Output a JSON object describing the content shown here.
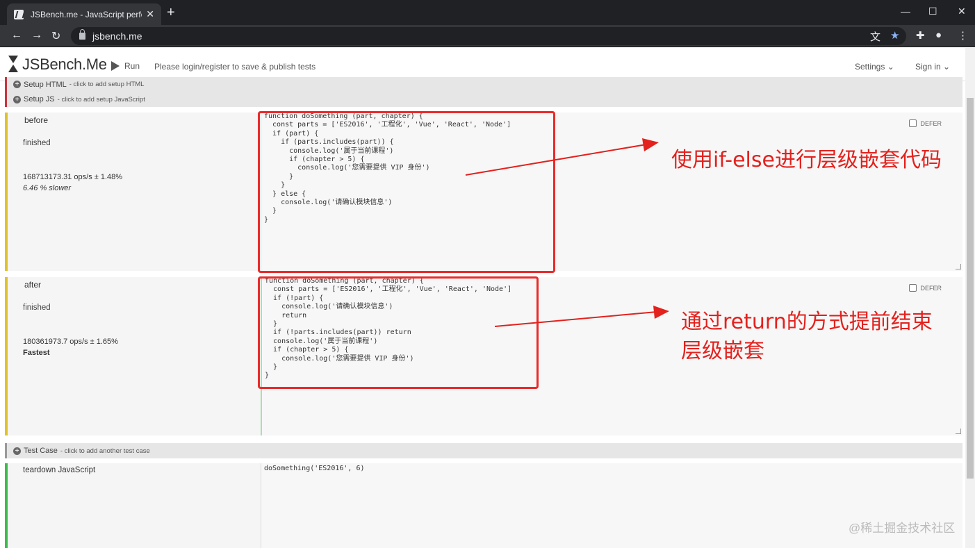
{
  "browser": {
    "tab_title": "JSBench.me - JavaScript perfo",
    "url": "jsbench.me"
  },
  "header": {
    "logo": "JSBench.Me",
    "run_label": "Run",
    "login_msg": "Please login/register to save & publish tests",
    "settings_label": "Settings",
    "signin_label": "Sign in"
  },
  "setup_html": {
    "label": "Setup HTML",
    "hint": "- click to add setup HTML"
  },
  "setup_js": {
    "label": "Setup JS",
    "hint": "- click to add setup JavaScript"
  },
  "cases": [
    {
      "name": "before",
      "status": "finished",
      "ops": "168713173.31 ops/s ± 1.48%",
      "comparison": "6.46 % slower",
      "defer_label": "DEFER",
      "code_lines": [
        "function doSomething (part, chapter) {",
        "  const parts = ['ES2016', '工程化', 'Vue', 'React', 'Node']",
        "  if (part) {",
        "    if (parts.includes(part)) {",
        "      console.log('属于当前课程')",
        "      if (chapter > 5) {",
        "        console.log('您需要提供 VIP 身份')",
        "      }",
        "    }",
        "  } else {",
        "    console.log('请确认模块信息')",
        "  }",
        "}"
      ]
    },
    {
      "name": "after",
      "status": "finished",
      "ops": "180361973.7 ops/s ± 1.65%",
      "comparison": "Fastest",
      "defer_label": "DEFER",
      "code_lines": [
        "function doSomething (part, chapter) {",
        "  const parts = ['ES2016', '工程化', 'Vue', 'React', 'Node']",
        "  if (!part) {",
        "    console.log('请确认模块信息')",
        "    return",
        "  }",
        "  if (!parts.includes(part)) return",
        "  console.log('属于当前课程')",
        "  if (chapter > 5) {",
        "    console.log('您需要提供 VIP 身份')",
        "  }",
        "}"
      ]
    }
  ],
  "test_case": {
    "label": "Test Case",
    "hint": "- click to add another test case"
  },
  "teardown": {
    "label": "teardown JavaScript",
    "code": "doSomething('ES2016', 6)"
  },
  "annotations": {
    "first": "使用if-else进行层级嵌套代码",
    "second_line1": "通过return的方式提前结束",
    "second_line2": "层级嵌套"
  },
  "watermark": "@稀土掘金技术社区",
  "colors": {
    "annotation_red": "#e3211d",
    "case_accent": "#e0c22a",
    "teardown_accent": "#3dbb4d"
  }
}
